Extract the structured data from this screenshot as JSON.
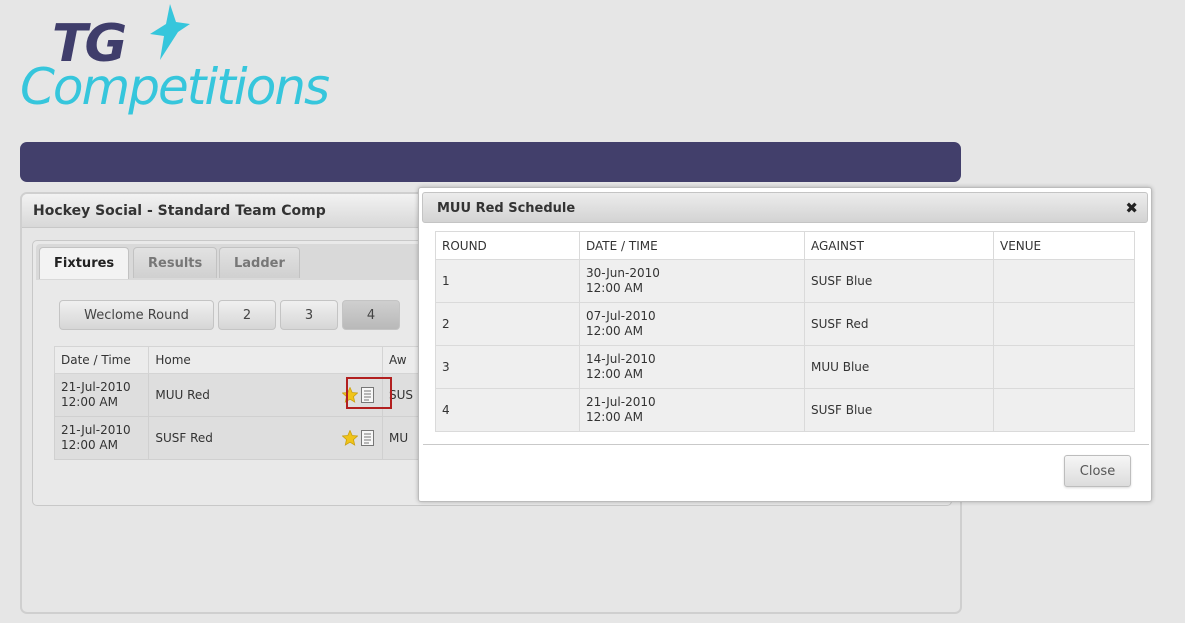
{
  "logo": {
    "line1": "TG",
    "line2": "Competitions"
  },
  "colors": {
    "nav_bar": "#423f6b",
    "logo_dark": "#3f3d6b",
    "logo_accent": "#36c6dc",
    "highlight": "#b21f1f"
  },
  "panel": {
    "title": "Hockey Social - Standard Team Comp"
  },
  "tabs": [
    {
      "label": "Fixtures",
      "active": true
    },
    {
      "label": "Results",
      "active": false
    },
    {
      "label": "Ladder",
      "active": false
    }
  ],
  "rounds": [
    {
      "label": "Weclome Round",
      "active": false
    },
    {
      "label": "2",
      "active": false
    },
    {
      "label": "3",
      "active": false
    },
    {
      "label": "4",
      "active": true
    }
  ],
  "fixtures": {
    "columns": [
      "Date / Time",
      "Home",
      "Aw"
    ],
    "rows": [
      {
        "date": "21-Jul-2010",
        "time": "12:00 AM",
        "home": "MUU Red",
        "away": "SUS"
      },
      {
        "date": "21-Jul-2010",
        "time": "12:00 AM",
        "home": "SUSF Red",
        "away": "MU"
      }
    ],
    "row_icons": [
      "star-icon",
      "doc-icon"
    ]
  },
  "modal": {
    "title": "MUU Red Schedule",
    "close_glyph": "✖",
    "columns": [
      "ROUND",
      "DATE / TIME",
      "AGAINST",
      "VENUE"
    ],
    "rows": [
      {
        "round": "1",
        "date": "30-Jun-2010",
        "time": "12:00 AM",
        "against": "SUSF Blue",
        "venue": ""
      },
      {
        "round": "2",
        "date": "07-Jul-2010",
        "time": "12:00 AM",
        "against": "SUSF Red",
        "venue": ""
      },
      {
        "round": "3",
        "date": "14-Jul-2010",
        "time": "12:00 AM",
        "against": "MUU Blue",
        "venue": ""
      },
      {
        "round": "4",
        "date": "21-Jul-2010",
        "time": "12:00 AM",
        "against": "SUSF Blue",
        "venue": ""
      }
    ],
    "close_label": "Close"
  }
}
